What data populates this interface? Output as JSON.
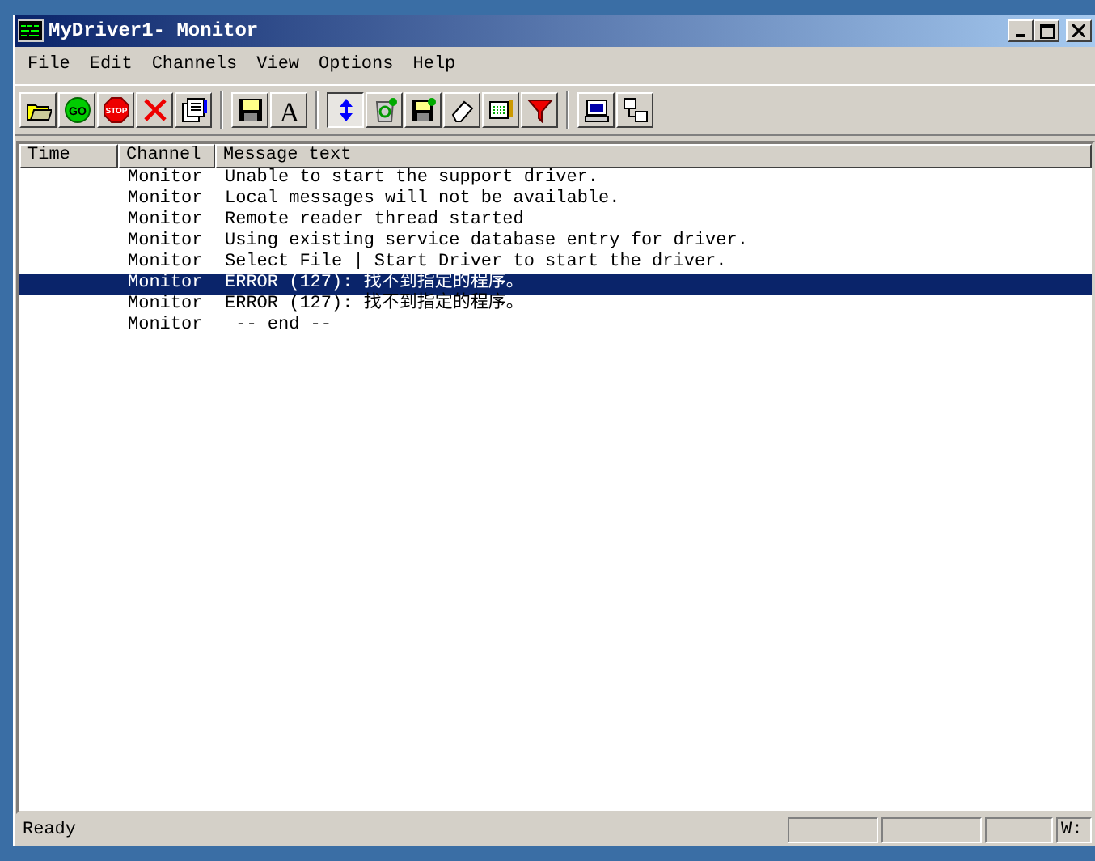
{
  "window": {
    "title": "MyDriver1- Monitor"
  },
  "menu": [
    "File",
    "Edit",
    "Channels",
    "View",
    "Options",
    "Help"
  ],
  "toolbar": [
    {
      "kind": "open",
      "pressed": false
    },
    {
      "kind": "go",
      "pressed": false,
      "label": "GO"
    },
    {
      "kind": "stop",
      "pressed": false,
      "label": "STOP"
    },
    {
      "kind": "delete",
      "pressed": false
    },
    {
      "kind": "properties",
      "pressed": false
    },
    {
      "kind": "sep"
    },
    {
      "kind": "save",
      "pressed": false
    },
    {
      "kind": "font",
      "pressed": false,
      "label": "A"
    },
    {
      "kind": "sep"
    },
    {
      "kind": "autoscroll",
      "pressed": true
    },
    {
      "kind": "recycle",
      "pressed": false
    },
    {
      "kind": "savelog",
      "pressed": false
    },
    {
      "kind": "eraser",
      "pressed": false
    },
    {
      "kind": "highlight",
      "pressed": false
    },
    {
      "kind": "filter",
      "pressed": false
    },
    {
      "kind": "sep"
    },
    {
      "kind": "computer",
      "pressed": false
    },
    {
      "kind": "network",
      "pressed": false
    }
  ],
  "table": {
    "columns": [
      "Time",
      "Channel",
      "Message text"
    ],
    "rows": [
      {
        "channel": "Monitor",
        "message": "Unable to start the support driver.",
        "selected": false
      },
      {
        "channel": "Monitor",
        "message": "Local messages will not be available.",
        "selected": false
      },
      {
        "channel": "Monitor",
        "message": "Remote reader thread started",
        "selected": false
      },
      {
        "channel": "Monitor",
        "message": "Using existing service database entry for driver.",
        "selected": false
      },
      {
        "channel": "Monitor",
        "message": "Select File | Start Driver to start the driver.",
        "selected": false
      },
      {
        "channel": "Monitor",
        "message": "ERROR (127): 找不到指定的程序。",
        "selected": true
      },
      {
        "channel": "Monitor",
        "message": "ERROR (127): 找不到指定的程序。",
        "selected": false
      },
      {
        "channel": "Monitor",
        "message": " -- end --",
        "selected": false
      }
    ]
  },
  "status_bar": {
    "text": "Ready",
    "panel_4": "W:"
  }
}
